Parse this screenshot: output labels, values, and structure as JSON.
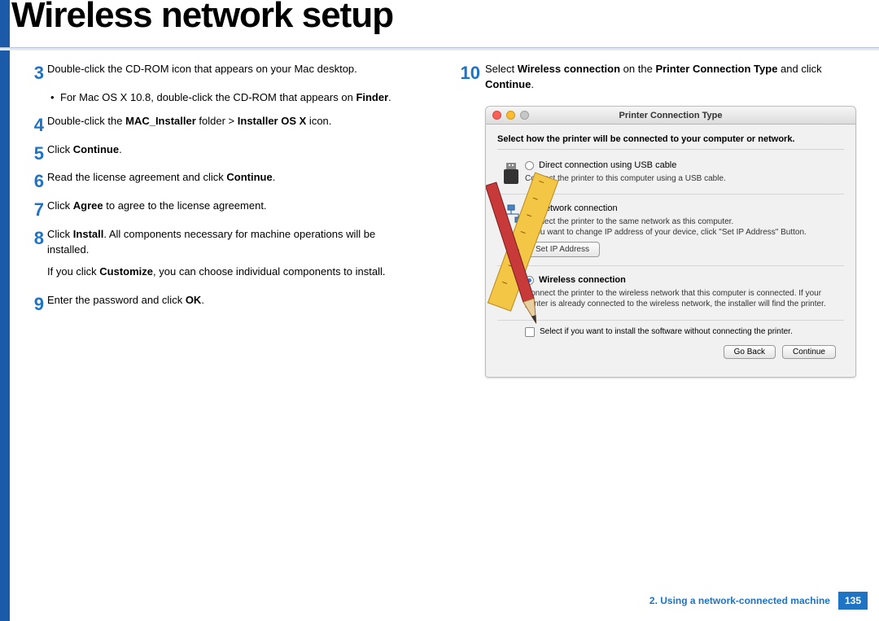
{
  "title": "Wireless network setup",
  "left_steps": {
    "3": "Double-click the CD-ROM icon that appears on your Mac desktop.",
    "3_bullet_pre": "For Mac OS X 10.8, double-click the CD-ROM that appears on ",
    "3_bullet_bold": "Finder",
    "3_bullet_post": ".",
    "4_pre": "Double-click the ",
    "4_b1": "MAC_Installer",
    "4_mid": " folder > ",
    "4_b2": "Installer OS X",
    "4_post": " icon.",
    "5_pre": "Click ",
    "5_b": "Continue",
    "5_post": ".",
    "6_pre": "Read the license agreement and click ",
    "6_b": "Continue",
    "6_post": ".",
    "7_pre": "Click ",
    "7_b": "Agree",
    "7_post": " to agree to the license agreement.",
    "8_pre": "Click ",
    "8_b": "Install",
    "8_post": ". All components necessary for machine operations will be installed.",
    "8_p2_pre": "If you click ",
    "8_p2_b": "Customize",
    "8_p2_post": ", you can choose individual components to install.",
    "9_pre": "Enter the password and click ",
    "9_b": "OK",
    "9_post": "."
  },
  "right_step": {
    "10_pre": "Select ",
    "10_b1": "Wireless connection",
    "10_mid": " on the ",
    "10_b2": "Printer Connection Type",
    "10_post": " and click ",
    "10_b3": "Continue",
    "10_end": "."
  },
  "macwin": {
    "title": "Printer Connection Type",
    "instruction": "Select how the printer will be connected to your computer or network.",
    "opt_usb_title": "Direct connection using USB cable",
    "opt_usb_desc": "Connect the printer to this computer using a USB cable.",
    "opt_net_title": "Network connection",
    "opt_net_desc": "Connect the printer to the same network as this computer.\nIf you want to change IP address of your device, click \"Set IP Address\" Button.",
    "set_ip": "Set IP Address",
    "opt_wl_title": "Wireless connection",
    "opt_wl_desc": "Connect the printer to the wireless network that this computer is connected.\nIf your printer is already connected to the wireless network, the installer will find the printer.",
    "check_label": "Select if you want to install the software without connecting the printer.",
    "btn_back": "Go Back",
    "btn_continue": "Continue"
  },
  "footer": {
    "section": "2.  Using a network-connected machine",
    "page": "135"
  }
}
